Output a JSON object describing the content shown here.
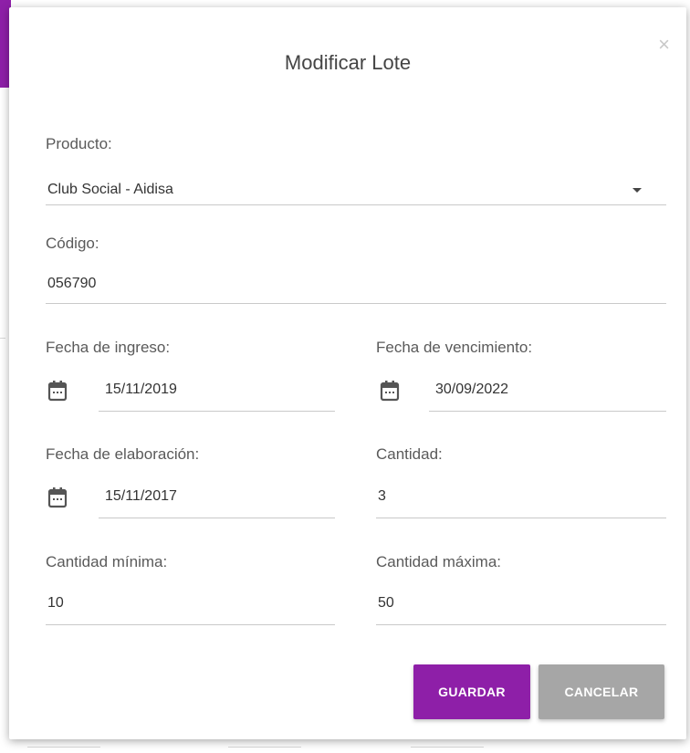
{
  "dialog": {
    "title": "Modificar Lote",
    "close_glyph": "×"
  },
  "form": {
    "producto": {
      "label": "Producto:",
      "value": "Club Social - Aidisa"
    },
    "codigo": {
      "label": "Código:",
      "value": "056790"
    },
    "fecha_ingreso": {
      "label": "Fecha de ingreso:",
      "value": "15/11/2019"
    },
    "fecha_vencimiento": {
      "label": "Fecha de vencimiento:",
      "value": "30/09/2022"
    },
    "fecha_elaboracion": {
      "label": "Fecha de elaboración:",
      "value": "15/11/2017"
    },
    "cantidad": {
      "label": "Cantidad:",
      "value": "3"
    },
    "cantidad_minima": {
      "label": "Cantidad mínima:",
      "value": "10"
    },
    "cantidad_maxima": {
      "label": "Cantidad máxima:",
      "value": "50"
    }
  },
  "actions": {
    "save_label": "GUARDAR",
    "cancel_label": "CANCELAR"
  },
  "colors": {
    "primary": "#8e1fa8",
    "secondary_button": "#a6a6a6"
  },
  "icons": {
    "select": "chevron-down-icon",
    "date": "calendar-icon",
    "close": "close-icon"
  }
}
